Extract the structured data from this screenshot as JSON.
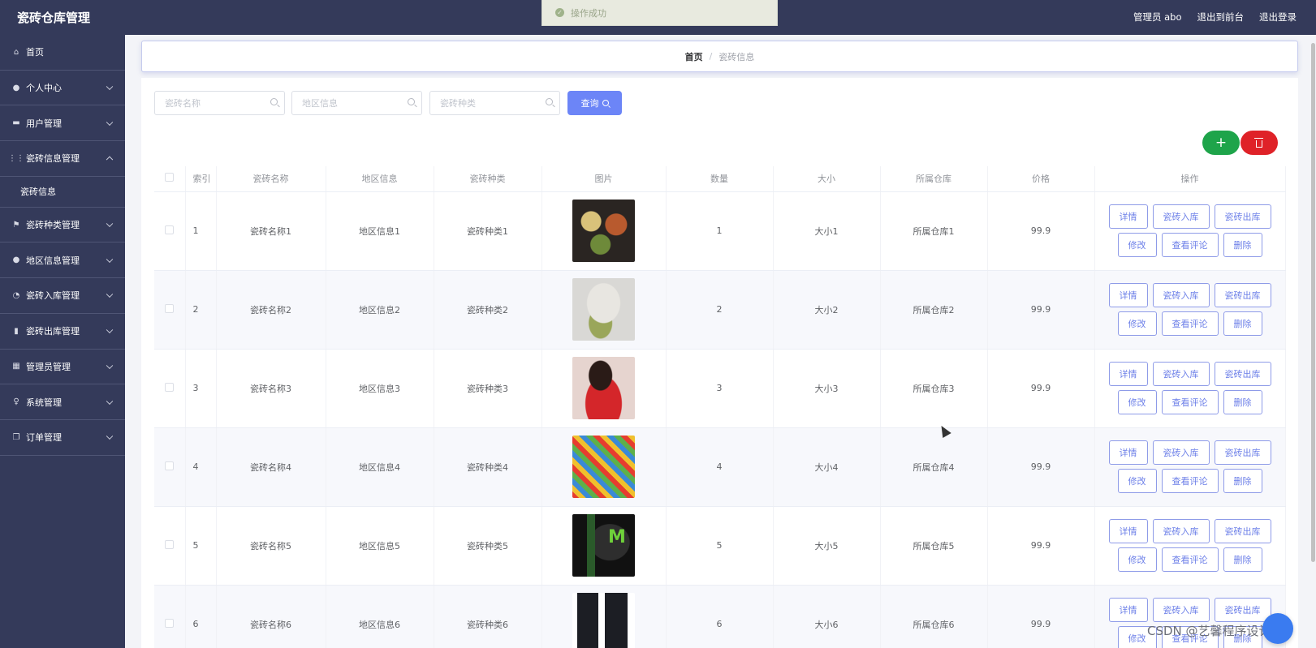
{
  "header": {
    "brand": "瓷砖仓库管理",
    "admin_label": "管理员 abo",
    "front_label": "退出到前台",
    "logout_label": "退出登录"
  },
  "toast": {
    "message": "操作成功"
  },
  "sidebar": {
    "items": [
      {
        "label": "首页",
        "icon": "home-icon"
      },
      {
        "label": "个人中心",
        "icon": "user-icon"
      },
      {
        "label": "用户管理",
        "icon": "monitor-icon"
      },
      {
        "label": "瓷砖信息管理",
        "icon": "grid-icon"
      },
      {
        "label": "瓷砖种类管理",
        "icon": "flag-icon"
      },
      {
        "label": "地区信息管理",
        "icon": "user-icon"
      },
      {
        "label": "瓷砖入库管理",
        "icon": "gauge-icon"
      },
      {
        "label": "瓷砖出库管理",
        "icon": "bar-chart-icon"
      },
      {
        "label": "管理员管理",
        "icon": "apps-icon"
      },
      {
        "label": "系统管理",
        "icon": "microphone-icon"
      },
      {
        "label": "订单管理",
        "icon": "copy-icon"
      }
    ],
    "sub_item": "瓷砖信息"
  },
  "breadcrumb": {
    "home": "首页",
    "separator": "/",
    "current": "瓷砖信息"
  },
  "search": {
    "name_placeholder": "瓷砖名称",
    "region_placeholder": "地区信息",
    "type_placeholder": "瓷砖种类",
    "query_label": "查询"
  },
  "toolbar": {
    "add_label": "+"
  },
  "table": {
    "headers": [
      "索引",
      "瓷砖名称",
      "地区信息",
      "瓷砖种类",
      "图片",
      "数量",
      "大小",
      "所属仓库",
      "价格",
      "操作"
    ],
    "rows": [
      {
        "index": "1",
        "name": "瓷砖名称1",
        "region": "地区信息1",
        "type": "瓷砖种类1",
        "qty": "1",
        "size": "大小1",
        "warehouse": "所属仓库1",
        "price": "99.9"
      },
      {
        "index": "2",
        "name": "瓷砖名称2",
        "region": "地区信息2",
        "type": "瓷砖种类2",
        "qty": "2",
        "size": "大小2",
        "warehouse": "所属仓库2",
        "price": "99.9"
      },
      {
        "index": "3",
        "name": "瓷砖名称3",
        "region": "地区信息3",
        "type": "瓷砖种类3",
        "qty": "3",
        "size": "大小3",
        "warehouse": "所属仓库3",
        "price": "99.9"
      },
      {
        "index": "4",
        "name": "瓷砖名称4",
        "region": "地区信息4",
        "type": "瓷砖种类4",
        "qty": "4",
        "size": "大小4",
        "warehouse": "所属仓库4",
        "price": "99.9"
      },
      {
        "index": "5",
        "name": "瓷砖名称5",
        "region": "地区信息5",
        "type": "瓷砖种类5",
        "qty": "5",
        "size": "大小5",
        "warehouse": "所属仓库5",
        "price": "99.9"
      },
      {
        "index": "6",
        "name": "瓷砖名称6",
        "region": "地区信息6",
        "type": "瓷砖种类6",
        "qty": "6",
        "size": "大小6",
        "warehouse": "所属仓库6",
        "price": "99.9"
      }
    ],
    "actions": {
      "detail": "详情",
      "stock_in": "瓷砖入库",
      "stock_out": "瓷砖出库",
      "edit": "修改",
      "comments": "查看评论",
      "delete": "删除"
    }
  },
  "watermark": "CSDN @艺馨程序设计",
  "colors": {
    "sidebar_bg": "#343a5a",
    "primary": "#6c85f7",
    "success": "#1ea44a",
    "danger": "#df2228"
  }
}
